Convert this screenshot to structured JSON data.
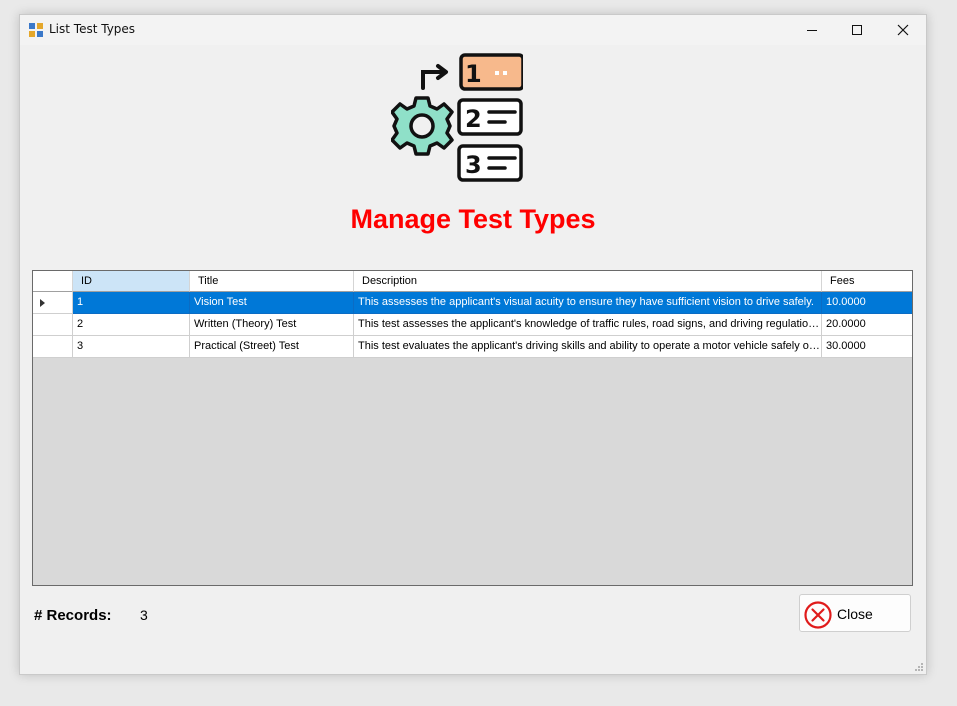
{
  "window": {
    "title": "List Test Types",
    "controls": [
      "minimize",
      "maximize",
      "close"
    ]
  },
  "header": {
    "icon": "test-types-list-icon",
    "title": "Manage Test Types",
    "title_color": "#ff0000"
  },
  "grid": {
    "columns": [
      "ID",
      "Title",
      "Description",
      "Fees"
    ],
    "selected_row_index": 0,
    "selection_color": "#0078d7",
    "rows": [
      {
        "id": "1",
        "title": "Vision Test",
        "description": "This assesses the applicant's visual acuity to ensure they have sufficient vision to drive safely.",
        "fees": "10.0000"
      },
      {
        "id": "2",
        "title": "Written (Theory) Test",
        "description": "This test assesses the applicant's knowledge of traffic rules, road signs, and driving regulations. ...",
        "fees": "20.0000"
      },
      {
        "id": "3",
        "title": "Practical (Street) Test",
        "description": "This test evaluates the applicant's driving skills and ability to operate a motor vehicle safely on p...",
        "fees": "30.0000"
      }
    ]
  },
  "footer": {
    "records_label": "# Records:",
    "records_value": "3",
    "close_button": "Close"
  }
}
